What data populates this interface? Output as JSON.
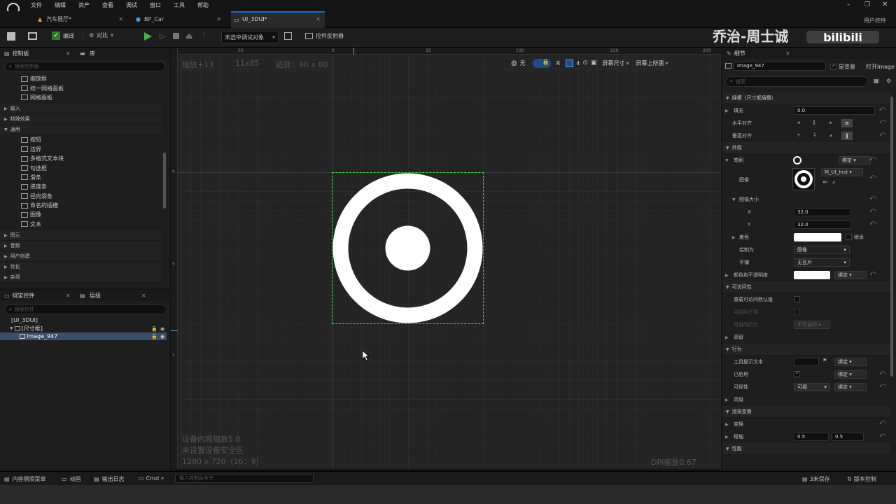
{
  "menu": [
    "文件",
    "编辑",
    "资产",
    "查看",
    "调试",
    "窗口",
    "工具",
    "帮助"
  ],
  "tabs": [
    {
      "label": "汽车展厅*"
    },
    {
      "label": "BP_Car"
    },
    {
      "label": "UI_3DUI*"
    }
  ],
  "window_right_label": "用户控件",
  "watermark": "乔治-周士诚",
  "toolbar": {
    "compile": "编译",
    "diff": "对比",
    "debug_select": "未选中调试对象",
    "reflector": "控件反射器"
  },
  "palette": {
    "title": "控制板",
    "library": "库",
    "search_placeholder": "搜索控制板",
    "top_items": [
      "缩放框",
      "统一网格面板",
      "网格面板"
    ],
    "categories_a": [
      "输入",
      "特殊效果",
      "通用"
    ],
    "common_items": [
      "按钮",
      "边界",
      "多格式文本块",
      "勾选框",
      "滑条",
      "进度条",
      "径向滑条",
      "命名的插槽",
      "图像",
      "文本"
    ],
    "categories_b": [
      "图元",
      "音频",
      "用户创建",
      "优化",
      "杂项"
    ]
  },
  "hierarchy": {
    "bind_tab": "绑定控件",
    "layers_tab": "层级",
    "search_placeholder": "搜索控件",
    "root": "[UI_3DUI]",
    "sizebox": "[尺寸框]",
    "image": "Image_947"
  },
  "viewport": {
    "zoom": "缩放+13",
    "size": "11x85",
    "selection": "选择：80 x 80",
    "ruler_top": [
      "50",
      "0",
      "50",
      "100",
      "150",
      "200"
    ],
    "ruler_left": [
      "0",
      "5",
      "1"
    ],
    "none_label": "无",
    "r_label": "R",
    "grid_num": "4",
    "screen_size": "屏幕尺寸",
    "fill_screen": "屏幕上所需",
    "device_scale": "设备内容缩放1.0",
    "safe_zone": "未设置设备安全区",
    "resolution": "1280 x 720（16：9）",
    "dpi": "DPI缩放0.67"
  },
  "details": {
    "title": "细节",
    "name": "Image_947",
    "is_variable": "是变量",
    "open_image": "打开Image",
    "search_placeholder": "搜索",
    "slot_section": "插槽（尺寸框插槽）",
    "padding_label": "填充",
    "padding_value": "0.0",
    "h_align": "水平对齐",
    "v_align": "垂直对齐",
    "appearance": "外观",
    "brush": "笔刷",
    "bind": "绑定",
    "image_label": "图像",
    "image_asset": "M_UI_Inst",
    "image_size": "图像大小",
    "x_label": "X",
    "x_value": "32.0",
    "y_label": "Y",
    "y_value": "32.0",
    "tint": "着色",
    "inherit": "继承",
    "draw_as": "绘制为",
    "draw_as_value": "图像",
    "tiling": "平铺",
    "tiling_value": "无瓦片",
    "color_opacity": "颜色和不透明度",
    "accessibility": "可访问性",
    "override_access": "重载可访问默认值",
    "can_children": "可访问子项",
    "access_behavior": "可访问行为",
    "access_behavior_value": "不可访问",
    "advanced": "高级",
    "behavior": "行为",
    "tooltip": "工具提示文本",
    "enabled": "已启用",
    "visibility": "可视性",
    "visibility_value": "可视",
    "advanced2": "高级",
    "render_transform": "渲染变换",
    "transform": "变换",
    "pivot": "枢轴",
    "pivot_x": "0.5",
    "pivot_y": "0.5",
    "performance": "性能"
  },
  "status": {
    "content_drawer": "内容侧滑菜单",
    "animation": "动画",
    "output_log": "输出日志",
    "cmd": "Cmd",
    "console_placeholder": "输入控制台命令",
    "unsaved": "3未保存",
    "source_control": "版本控制"
  }
}
